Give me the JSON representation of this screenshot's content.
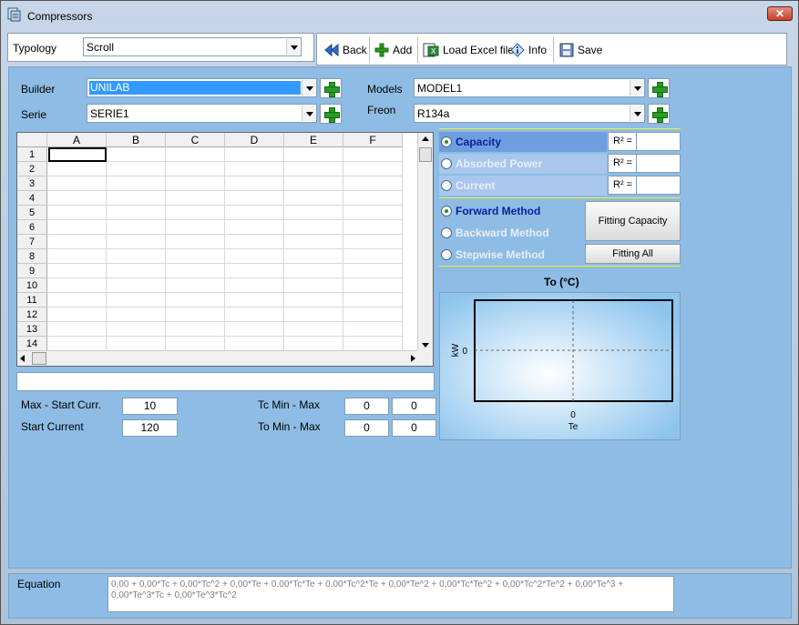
{
  "window": {
    "title": "Compressors",
    "close": "✕"
  },
  "typology": {
    "label": "Typology",
    "value": "Scroll"
  },
  "toolbar": {
    "back": "Back",
    "add": "Add",
    "load_excel": "Load Excel file",
    "info": "Info",
    "save": "Save"
  },
  "form": {
    "builder_label": "Builder",
    "builder_value": "UNILAB",
    "serie_label": "Serie",
    "serie_value": "SERIE1",
    "models_label": "Models",
    "models_value": "MODEL1",
    "freon_label": "Freon",
    "freon_value": "R134a"
  },
  "grid": {
    "columns": [
      "A",
      "B",
      "C",
      "D",
      "E",
      "F"
    ],
    "rows": [
      "1",
      "2",
      "3",
      "4",
      "5",
      "6",
      "7",
      "8",
      "9",
      "10",
      "11",
      "12",
      "13",
      "14"
    ]
  },
  "params": {
    "max_start_curr_label": "Max - Start Curr.",
    "max_start_curr_value": "10",
    "start_current_label": "Start Current",
    "start_current_value": "120",
    "tc_label": "Tc Min - Max",
    "tc_min": "0",
    "tc_max": "0",
    "to_label": "To Min - Max",
    "to_min": "0",
    "to_max": "0"
  },
  "outputs": [
    {
      "label": "Capacity",
      "r2": "R² =",
      "selected": true
    },
    {
      "label": "Absorbed Power",
      "r2": "R² =",
      "selected": false
    },
    {
      "label": "Current",
      "r2": "R² =",
      "selected": false
    }
  ],
  "methods": [
    {
      "label": "Forward Method",
      "selected": true
    },
    {
      "label": "Backward Method",
      "selected": false
    },
    {
      "label": "Stepwise  Method",
      "selected": false
    }
  ],
  "buttons": {
    "fitting_capacity": "Fitting Capacity",
    "fitting_all": "Fitting All"
  },
  "chart": {
    "title": "To (°C)",
    "y_label": "kW",
    "y_tick": "0",
    "x_tick": "0",
    "x_label": "Te"
  },
  "equation": {
    "label": "Equation",
    "text": "0,00 + 0,00*Tc + 0,00*Tc^2 + 0,00*Te + 0,00*Tc*Te + 0,00*Tc^2*Te + 0,00*Te^2 + 0,00*Tc*Te^2 + 0,00*Tc^2*Te^2 + 0,00*Te^3 + 0,00*Te^3*Tc + 0,00*Te^3*Tc^2"
  },
  "colors": {
    "panel": "#8ebce4",
    "highlight": "#3399ff",
    "active_text": "#0b1f9e",
    "inactive_text": "#e8eef6"
  }
}
